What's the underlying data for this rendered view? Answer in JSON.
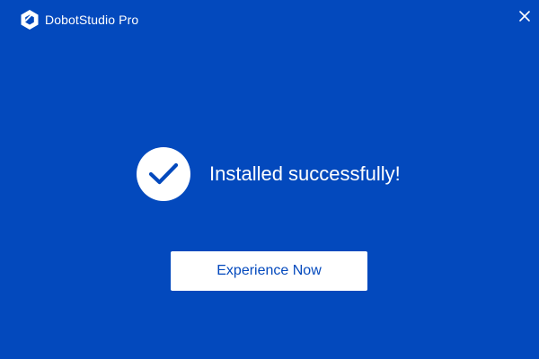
{
  "window": {
    "title": "DobotStudio Pro",
    "background_color": "#0349bd",
    "logo_icon": "dobot-logo-icon",
    "close_icon": "close-icon"
  },
  "main": {
    "status_icon": "checkmark-icon",
    "status_message": "Installed successfully!",
    "primary_button_label": "Experience Now",
    "primary_button_text_color": "#0349bd"
  }
}
